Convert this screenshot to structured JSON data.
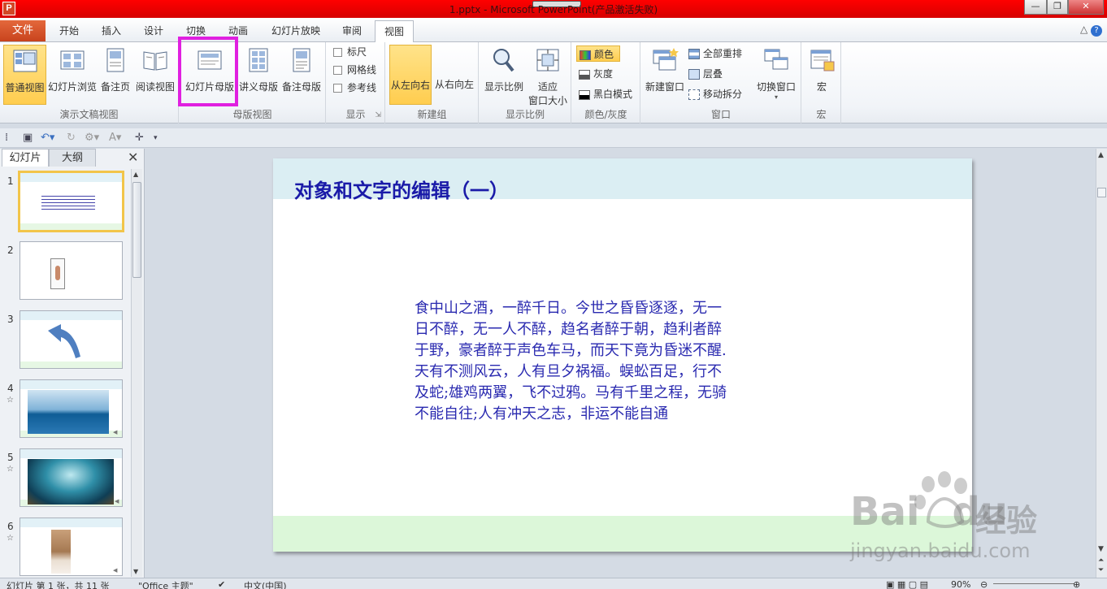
{
  "window": {
    "title": "1.pptx - Microsoft PowerPoint(产品激活失败)",
    "app_icon_letter": "P",
    "controls": [
      "—",
      "❐",
      "✕"
    ]
  },
  "tabs": {
    "file": "文件",
    "items": [
      "开始",
      "插入",
      "设计",
      "切换",
      "动画",
      "幻灯片放映",
      "审阅",
      "视图"
    ],
    "active_index": 7
  },
  "ribbon": {
    "presentation_views": {
      "label": "演示文稿视图",
      "buttons": [
        "普通视图",
        "幻灯片浏览",
        "备注页",
        "阅读视图"
      ],
      "active": "普通视图"
    },
    "master_views": {
      "label": "母版视图",
      "buttons": [
        "幻灯片母版",
        "讲义母版",
        "备注母版"
      ],
      "highlighted": "幻灯片母版"
    },
    "show": {
      "label": "显示",
      "checkboxes": [
        "标尺",
        "网格线",
        "参考线"
      ]
    },
    "new_group": {
      "label": "新建组",
      "buttons": [
        "从左向右",
        "从右向左"
      ]
    },
    "zoom": {
      "label": "显示比例",
      "buttons": [
        "显示比例",
        "适应",
        "窗口大小"
      ]
    },
    "color": {
      "label": "颜色/灰度",
      "items": [
        "颜色",
        "灰度",
        "黑白模式"
      ],
      "selected": "颜色"
    },
    "window_group": {
      "label": "窗口",
      "new_window": "新建窗口",
      "items": [
        "全部重排",
        "层叠",
        "移动拆分"
      ],
      "switch": "切换窗口"
    },
    "macro": {
      "label": "宏",
      "button": "宏"
    }
  },
  "left_pane": {
    "tabs": [
      "幻灯片",
      "大纲"
    ],
    "close": "✕",
    "slides": [
      {
        "num": "1",
        "star": ""
      },
      {
        "num": "2",
        "star": ""
      },
      {
        "num": "3",
        "star": ""
      },
      {
        "num": "4",
        "star": "☆"
      },
      {
        "num": "5",
        "star": "☆"
      },
      {
        "num": "6",
        "star": "☆"
      }
    ]
  },
  "slide": {
    "title": "对象和文字的编辑（一）",
    "body_lines": [
      " 食中山之酒，一醉千日。今世之昏昏逐逐，无一",
      "日不醉，无一人不醉，趋名者醉于朝，趋利者醉",
      "于野，豪者醉于声色车马，而天下竟为昏迷不醒.",
      "天有不测风云，人有旦夕祸福。蜈蚣百足，行不",
      "及蛇;雄鸡两翼，飞不过鸦。马有千里之程，无骑",
      "不能自往;人有冲天之志，非运不能自通"
    ]
  },
  "watermark": {
    "brand": "Bai",
    "brand2": "du",
    "cn": "经验",
    "url": "jingyan.baidu.com"
  },
  "status": {
    "slide_info": "幻灯片 第 1 张，共 11 张",
    "theme": "\"Office 主题\"",
    "language": "中文(中国)",
    "zoom": "90%"
  },
  "colors": {
    "title_bar": "#e00000",
    "file_tab": "#d24726",
    "active_button": "#ffcd4f",
    "highlight_box": "#e020e0",
    "slide_title": "#1a1aa8"
  }
}
